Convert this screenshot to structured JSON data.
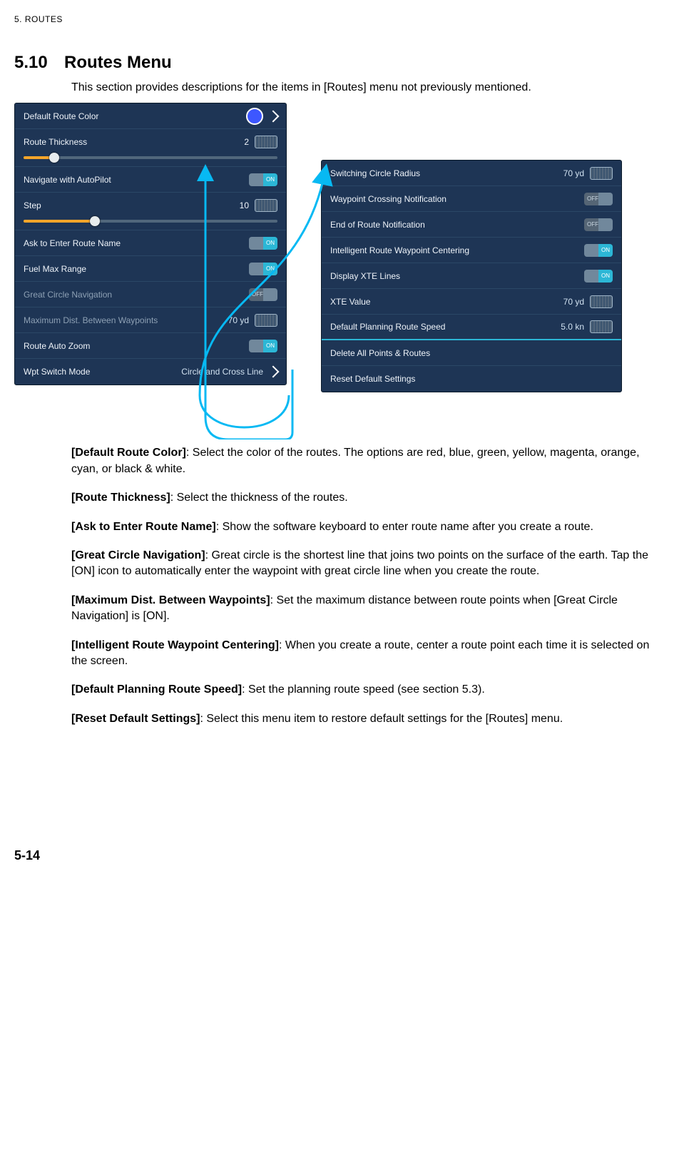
{
  "page": {
    "header": "5.  ROUTES",
    "section_number": "5.10",
    "section_title": "Routes Menu",
    "intro": "This section provides descriptions for the items in [Routes] menu not previously mentioned.",
    "page_number": "5-14"
  },
  "left_panel": {
    "default_route_color": "Default Route Color",
    "route_thickness": {
      "label": "Route Thickness",
      "value": "2",
      "percent": 12
    },
    "navigate_autopilot": {
      "label": "Navigate with AutoPilot",
      "state": "ON"
    },
    "step": {
      "label": "Step",
      "value": "10",
      "percent": 28
    },
    "ask_enter": {
      "label": "Ask to Enter Route Name",
      "state": "ON"
    },
    "fuel_max": {
      "label": "Fuel Max Range",
      "state": "ON"
    },
    "great_circle": {
      "label": "Great Circle Navigation",
      "state": "OFF"
    },
    "max_dist": {
      "label": "Maximum Dist. Between Waypoints",
      "value": "70 yd"
    },
    "route_auto_zoom": {
      "label": "Route Auto Zoom",
      "state": "ON"
    },
    "wpt_switch": {
      "label": "Wpt Switch Mode",
      "value": "Circle and Cross Line"
    }
  },
  "right_panel": {
    "switch_radius": {
      "label": "Switching Circle Radius",
      "value": "70 yd"
    },
    "wpt_cross_notif": {
      "label": "Waypoint Crossing Notification",
      "state": "OFF"
    },
    "end_route_notif": {
      "label": "End of Route Notification",
      "state": "OFF"
    },
    "int_centering": {
      "label": "Intelligent Route Waypoint Centering",
      "state": "ON"
    },
    "xte_lines": {
      "label": "Display XTE Lines",
      "state": "ON"
    },
    "xte_value": {
      "label": "XTE Value",
      "value": "70 yd"
    },
    "def_speed": {
      "label": "Default Planning Route Speed",
      "value": "5.0 kn"
    },
    "delete_all": "Delete All Points & Routes",
    "reset": "Reset Default Settings"
  },
  "descriptions": [
    {
      "term": "[Default Route Color]",
      "text": ": Select the color of the routes. The options are red, blue, green, yellow, magenta, orange, cyan, or black & white."
    },
    {
      "term": "[Route Thickness]",
      "text": ": Select the thickness of the routes."
    },
    {
      "term": "[Ask to Enter Route Name]",
      "text": ": Show the software keyboard to enter route name after you create a route."
    },
    {
      "term": "[Great Circle Navigation]",
      "text": ": Great circle is the shortest line that joins two points on the surface of the earth. Tap the [ON] icon to automatically enter the waypoint with great circle line when you create the route."
    },
    {
      "term": "[Maximum Dist. Between Waypoints]",
      "text": ": Set the maximum distance between route points when [Great Circle Navigation] is [ON]."
    },
    {
      "term": "[Intelligent Route Waypoint Centering]",
      "text": ": When you create a route, center a route point each time it is selected on the screen."
    },
    {
      "term": "[Default Planning Route Speed]",
      "text": ": Set the planning route speed (see section 5.3)."
    },
    {
      "term": "[Reset Default Settings]",
      "text": ": Select this menu item to restore default settings for the [Routes] menu."
    }
  ]
}
